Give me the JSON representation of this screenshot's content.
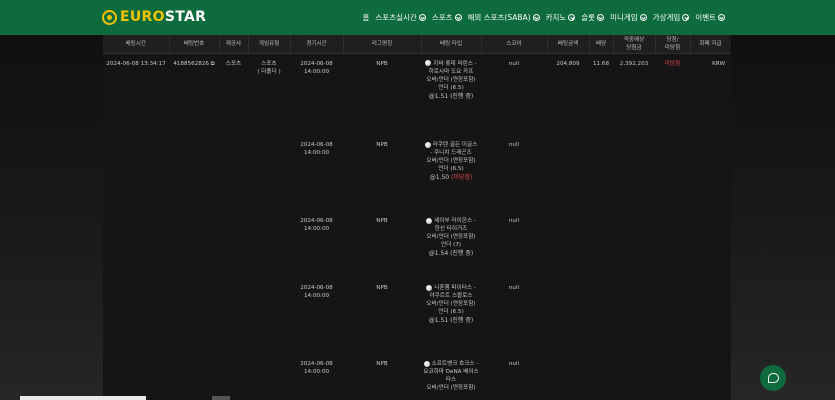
{
  "brand": {
    "logo_part1": "EURO",
    "logo_part2": "STAR"
  },
  "nav": [
    {
      "label": "홈",
      "has_chevron": false
    },
    {
      "label": "스포츠실시간",
      "has_chevron": true
    },
    {
      "label": "스포츠",
      "has_chevron": true
    },
    {
      "label": "해외 스포츠(SABA)",
      "has_chevron": true
    },
    {
      "label": "카지노",
      "has_chevron": true
    },
    {
      "label": "슬롯",
      "has_chevron": true
    },
    {
      "label": "미니게임",
      "has_chevron": true
    },
    {
      "label": "가상게임",
      "has_chevron": true
    },
    {
      "label": "이벤트",
      "has_chevron": true
    }
  ],
  "table": {
    "headers": [
      "베팅시간",
      "베팅번호",
      "제공사",
      "게임유형",
      "경기시간",
      "리그명칭",
      "베팅 타입",
      "스코어",
      "베팅금액",
      "배당",
      "적중예상\n당첨금",
      "당첨/\n미당첨",
      "화폐 지급"
    ],
    "main_row": {
      "bet_time": "2024-06-08 13:34:17",
      "bet_no": "4188562826",
      "provider": "스포츠",
      "game_type": "스포츠\n( 다폴더 )",
      "amount": "204,809",
      "odds": "11.68",
      "expected": "2,392,203",
      "result": "미당첨",
      "currency": "KRW"
    },
    "legs": [
      {
        "match_time": "2024-06-08\n14:00:00",
        "league": "NPB",
        "teams": "지바 롯데 마린스 - 히로시마 도요 카프",
        "market": "오버/언더 (연장포함)",
        "pick": "언더 (6.5)",
        "odds_prefix": "@1.51",
        "status": "(진행 중)",
        "status_red": false,
        "score": "null"
      },
      {
        "match_time": "2024-06-08\n14:00:00",
        "league": "NPB",
        "teams": "라쿠텐 골든 이글스 - 주니치 드래곤즈",
        "market": "오버/언더 (연장포함)",
        "pick": "언더 (6.5)",
        "odds_prefix": "@1.50",
        "status": "(미당첨)",
        "status_red": true,
        "score": "null"
      },
      {
        "match_time": "2024-06-08\n14:00:00",
        "league": "NPB",
        "teams": "세이부 라이온스 - 한신 타이거즈",
        "market": "오버/언더 (연장포함)",
        "pick": "언더 (7)",
        "odds_prefix": "@1.54",
        "status": "(진행 중)",
        "status_red": false,
        "score": "null"
      },
      {
        "match_time": "2024-06-08\n14:00:00",
        "league": "NPB",
        "teams": "니혼햄 파이터스 - 야쿠르트 스왈로스",
        "market": "오버/언더 (연장포함)",
        "pick": "언더 (6.5)",
        "odds_prefix": "@1.51",
        "status": "(진행 중)",
        "status_red": false,
        "score": "null"
      },
      {
        "match_time": "2024-06-08\n14:00:00",
        "league": "NPB",
        "teams": "소프트뱅크 호크스 - 요코하마 DeNA 베이스타스",
        "market": "오버/언더 (연장포함)",
        "pick": "",
        "odds_prefix": "",
        "status": "",
        "status_red": false,
        "score": "null"
      }
    ]
  },
  "icons": {
    "copy": "copy-icon",
    "chat": "chat-icon",
    "ball": "baseball-icon"
  },
  "colors": {
    "header_green": "#0d6b3d",
    "logo_yellow": "#f2c400",
    "loss_red": "#e0484f"
  }
}
